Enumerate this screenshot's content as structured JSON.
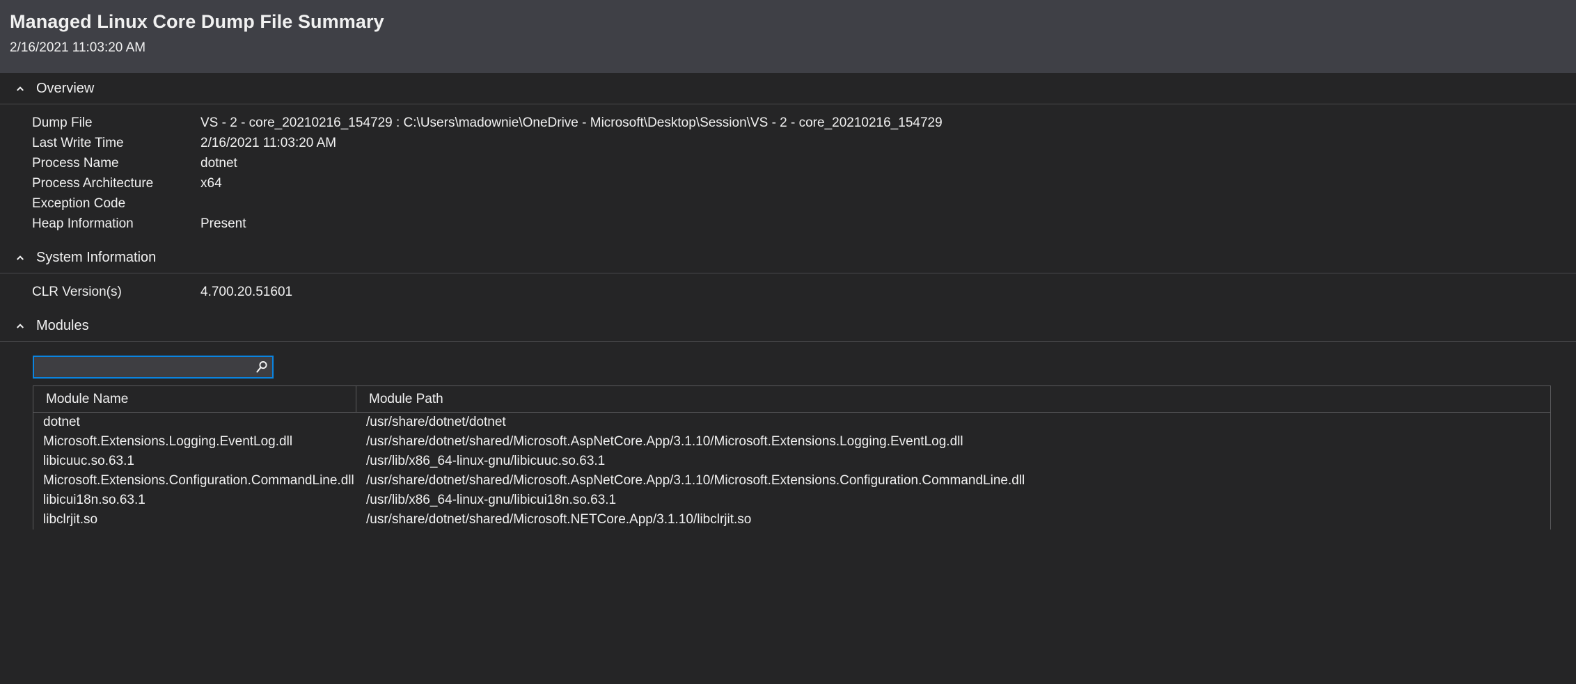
{
  "header": {
    "title": "Managed Linux Core Dump File Summary",
    "timestamp": "2/16/2021 11:03:20 AM",
    "background": "#3F4046"
  },
  "accent_color": "#0A84E0",
  "sections": {
    "overview": {
      "title": "Overview",
      "chevron_icon": "chevron-up-icon",
      "rows": [
        {
          "label": "Dump File",
          "value": "VS - 2 - core_20210216_154729 : C:\\Users\\madownie\\OneDrive - Microsoft\\Desktop\\Session\\VS - 2 - core_20210216_154729"
        },
        {
          "label": "Last Write Time",
          "value": "2/16/2021 11:03:20 AM"
        },
        {
          "label": "Process Name",
          "value": "dotnet"
        },
        {
          "label": "Process Architecture",
          "value": "x64"
        },
        {
          "label": "Exception Code",
          "value": ""
        },
        {
          "label": "Heap Information",
          "value": "Present"
        }
      ]
    },
    "system_information": {
      "title": "System Information",
      "chevron_icon": "chevron-up-icon",
      "rows": [
        {
          "label": "CLR Version(s)",
          "value": "4.700.20.51601"
        }
      ]
    },
    "modules": {
      "title": "Modules",
      "chevron_icon": "chevron-up-icon",
      "search": {
        "value": "",
        "placeholder": "",
        "icon": "search-icon"
      },
      "columns": [
        "Module Name",
        "Module Path"
      ],
      "rows": [
        {
          "name": "dotnet",
          "path": "/usr/share/dotnet/dotnet"
        },
        {
          "name": "Microsoft.Extensions.Logging.EventLog.dll",
          "path": "/usr/share/dotnet/shared/Microsoft.AspNetCore.App/3.1.10/Microsoft.Extensions.Logging.EventLog.dll"
        },
        {
          "name": "libicuuc.so.63.1",
          "path": "/usr/lib/x86_64-linux-gnu/libicuuc.so.63.1"
        },
        {
          "name": "Microsoft.Extensions.Configuration.CommandLine.dll",
          "path": "/usr/share/dotnet/shared/Microsoft.AspNetCore.App/3.1.10/Microsoft.Extensions.Configuration.CommandLine.dll"
        },
        {
          "name": "libicui18n.so.63.1",
          "path": "/usr/lib/x86_64-linux-gnu/libicui18n.so.63.1"
        },
        {
          "name": "libclrjit.so",
          "path": "/usr/share/dotnet/shared/Microsoft.NETCore.App/3.1.10/libclrjit.so"
        }
      ]
    }
  }
}
